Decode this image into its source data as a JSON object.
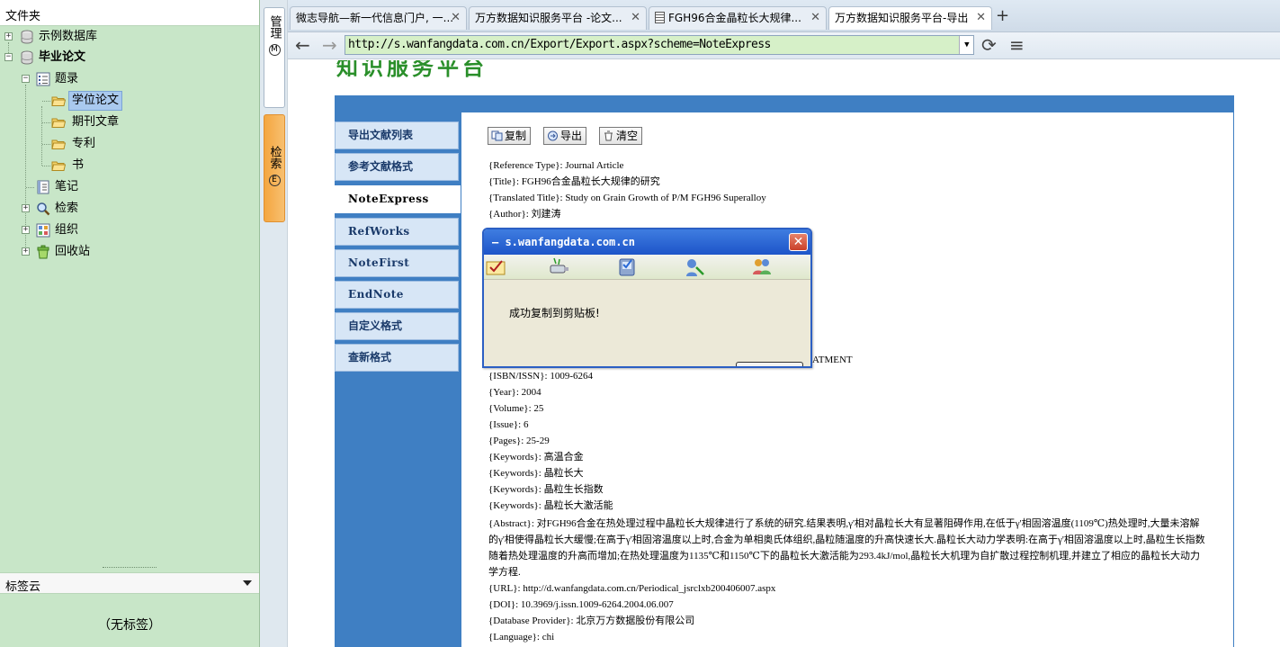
{
  "left_panel": {
    "folder_header": "文件夹",
    "tree": [
      {
        "label": "示例数据库",
        "expander": "+"
      },
      {
        "label": "毕业论文",
        "expander": "−"
      },
      {
        "label": "题录",
        "expander": "−"
      },
      {
        "label": "学位论文"
      },
      {
        "label": "期刊文章"
      },
      {
        "label": "专利"
      },
      {
        "label": "书"
      },
      {
        "label": "笔记"
      },
      {
        "label": "检索",
        "expander": "+"
      },
      {
        "label": "组织",
        "expander": "+"
      },
      {
        "label": "回收站",
        "expander": "+"
      }
    ],
    "tag_cloud_header": "标签云",
    "tag_cloud_empty": "（无标签）"
  },
  "side_tabs": {
    "manage": "管理",
    "manage_key": "M",
    "search": "检索",
    "search_key": "E"
  },
  "browser": {
    "tabs": [
      {
        "title": "微志导航—新一代信息门户, 一..."
      },
      {
        "title": "万方数据知识服务平台 -论文..."
      },
      {
        "title": "FGH96合金晶粒长大规律..."
      },
      {
        "title": "万方数据知识服务平台-导出"
      }
    ],
    "new_tab": "+",
    "back": "←",
    "forward": "→",
    "url": "http://s.wanfangdata.com.cn/Export/Export.aspx?scheme=NoteExpress",
    "reload": "⟳",
    "menu": "≡"
  },
  "page": {
    "logo_text": "知识服务平台",
    "menu": [
      {
        "label": "导出文献列表"
      },
      {
        "label": "参考文献格式"
      },
      {
        "label": "NoteExpress"
      },
      {
        "label": "RefWorks"
      },
      {
        "label": "NoteFirst"
      },
      {
        "label": "EndNote"
      },
      {
        "label": "自定义格式"
      },
      {
        "label": "查新格式"
      }
    ],
    "buttons": {
      "copy": "复制",
      "export": "导出",
      "clear": "清空"
    },
    "reference_lines": [
      "{Reference Type}: Journal Article",
      "{Title}: FGH96合金晶粒长大规律的研究",
      "{Translated Title}: Study on Grain Growth of P/M FGH96 Superalloy",
      "{Author}: 刘建涛"
    ],
    "cut_line_tail": "ATMENT",
    "reference_lines_2": [
      "{ISBN/ISSN}: 1009-6264",
      "{Year}: 2004",
      "{Volume}: 25",
      "{Issue}: 6",
      "{Pages}: 25-29",
      "{Keywords}: 高温合金",
      "{Keywords}: 晶粒长大",
      "{Keywords}: 晶粒生长指数",
      "{Keywords}: 晶粒长大激活能"
    ],
    "abstract": "{Abstract}: 对FGH96合金在热处理过程中晶粒长大规律进行了系统的研究.结果表明,γ'相对晶粒长大有显著阻碍作用,在低于γ'相固溶温度(1109℃)热处理时,大量未溶解的γ'相使得晶粒长大缓慢;在高于γ'相固溶温度以上时,合金为单相奥氏体组织,晶粒随温度的升高快速长大.晶粒长大动力学表明:在高于γ'相固溶温度以上时,晶粒生长指数随着热处理温度的升高而增加;在热处理温度为1135℃和1150℃下的晶粒长大激活能为293.4kJ/mol,晶粒长大机理为自扩散过程控制机理,并建立了相应的晶粒长大动力学方程.",
    "reference_lines_3": [
      "{URL}: http://d.wanfangdata.com.cn/Periodical_jsrclxb200406007.aspx",
      "{DOI}: 10.3969/j.issn.1009-6264.2004.06.007",
      "{Database Provider}: 北京万方数据股份有限公司",
      "{Language}: chi"
    ]
  },
  "dialog": {
    "title": "– s.wanfangdata.com.cn",
    "close": "✕",
    "message": "成功复制到剪贴板!"
  }
}
